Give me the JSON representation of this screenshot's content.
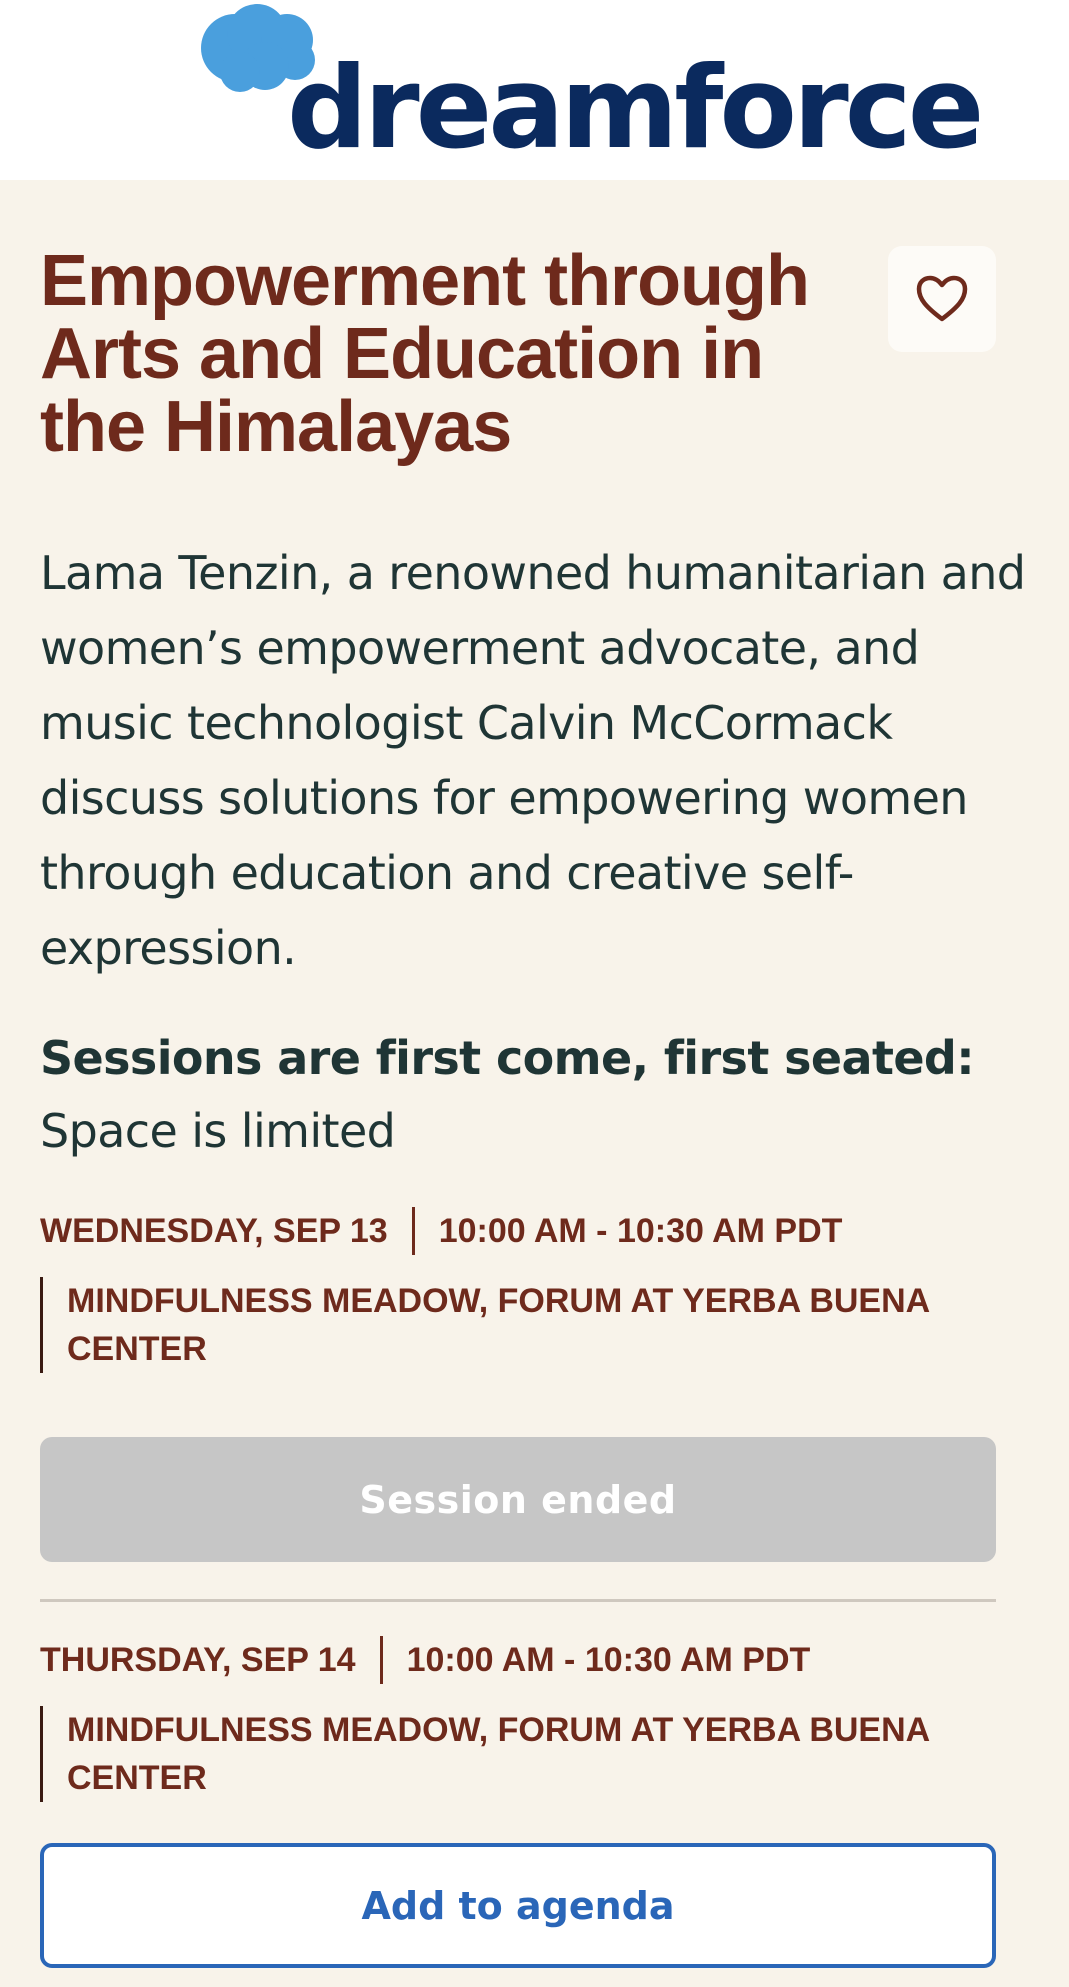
{
  "header": {
    "logo_text": "dreamforce",
    "logo_mark": "®"
  },
  "colors": {
    "brand_blue": "#0b2a5e",
    "cloud_blue": "#4a9fdd",
    "title_brown": "#6e2a1c",
    "link_blue": "#2a66b8",
    "background": "#f8f3ea"
  },
  "session": {
    "title_lines": [
      "Empowerment through",
      "Arts and Education in",
      "the Himalayas"
    ],
    "favorite_icon": "heart-outline-icon",
    "description": "Lama Tenzin, a renowned humanitarian and women’s empowerment advocate, and music technologist Calvin McCormack discuss solutions for empowering women through education and creative self-expression.",
    "notice_bold": "Sessions are first come, first seated:",
    "notice_rest": "Space is limited"
  },
  "occurrences": [
    {
      "date": "WEDNESDAY, SEP 13",
      "time": "10:00 AM - 10:30 AM PDT",
      "location_line1": "MINDFULNESS MEADOW, FORUM AT YERBA BUENA",
      "location_line2": "CENTER",
      "button_label": "Session ended"
    },
    {
      "date": "THURSDAY, SEP 14",
      "time": "10:00 AM - 10:30 AM PDT",
      "location_line1": "MINDFULNESS MEADOW, FORUM AT YERBA BUENA",
      "location_line2": "CENTER",
      "button_label": "Add to agenda"
    }
  ]
}
